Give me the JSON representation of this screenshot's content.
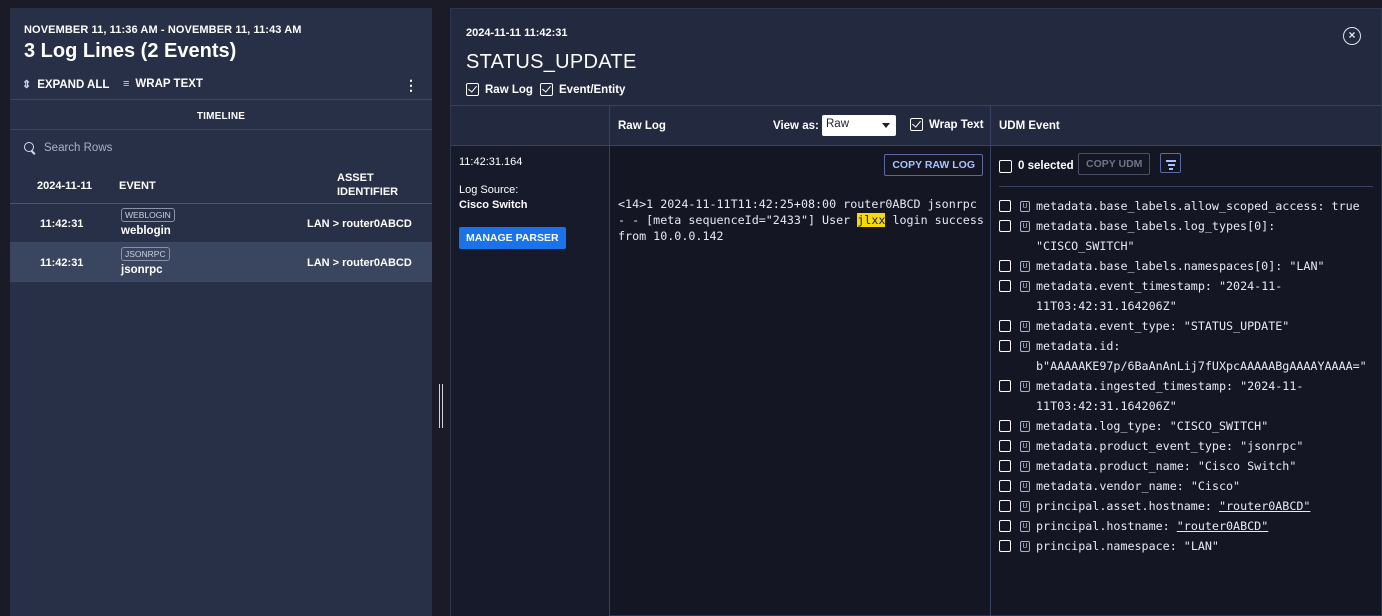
{
  "left": {
    "time_range": "NOVEMBER 11, 11:36 AM - NOVEMBER 11, 11:43 AM",
    "count_title": "3 Log Lines (2 Events)",
    "toolbar": {
      "expand_all": "EXPAND ALL",
      "wrap_text": "WRAP TEXT"
    },
    "tab": "TIMELINE",
    "search_placeholder": "Search Rows",
    "table": {
      "headers": [
        "2024-11-11",
        "EVENT",
        "ASSET",
        "IDENTIFIER"
      ],
      "rows": [
        {
          "time": "11:42:31",
          "badge": "WEBLOGIN",
          "event": "weblogin",
          "asset": "LAN > router0ABCD",
          "selected": false
        },
        {
          "time": "11:42:31",
          "badge": "JSONRPC",
          "event": "jsonrpc",
          "asset": "LAN > router0ABCD",
          "selected": true
        }
      ]
    }
  },
  "detail": {
    "timestamp": "2024-11-11 11:42:31",
    "event_type": "STATUS_UPDATE",
    "options": {
      "raw_log": "Raw Log",
      "event_entity": "Event/Entity"
    },
    "columns": {
      "raw_log": "Raw Log",
      "view_as": "View as:",
      "view_value": "Raw",
      "wrap_text": "Wrap Text",
      "udm_event": "UDM Event"
    },
    "meta": {
      "time": "11:42:31.164",
      "log_source_label": "Log Source:",
      "log_source_value": "Cisco Switch",
      "manage_parser": "MANAGE PARSER"
    },
    "raw": {
      "copy_button": "COPY RAW LOG",
      "before": "<14>1 2024-11-11T11:42:25+08:00 router0ABCD jsonrpc - - [meta sequenceId=\"2433\"] User ",
      "highlight": "jlxx",
      "after": " login success from 10.0.0.142"
    },
    "udm": {
      "selected_count": "0 selected",
      "copy_button": "COPY UDM",
      "fields": [
        {
          "key": "metadata.base_labels.allow_scoped_access:",
          "value": "true",
          "link": false
        },
        {
          "key": "metadata.base_labels.log_types[0]:",
          "value": "\"CISCO_SWITCH\"",
          "link": false
        },
        {
          "key": "metadata.base_labels.namespaces[0]:",
          "value": "\"LAN\"",
          "link": false
        },
        {
          "key": "metadata.event_timestamp:",
          "value": "\"2024-11-11T03:42:31.164206Z\"",
          "link": false
        },
        {
          "key": "metadata.event_type:",
          "value": "\"STATUS_UPDATE\"",
          "link": false
        },
        {
          "key": "metadata.id:",
          "value": "b\"AAAAAKE97p/6BaAnAnLij7fUXpcAAAAABgAAAAYAAAA=\"",
          "link": false
        },
        {
          "key": "metadata.ingested_timestamp:",
          "value": "\"2024-11-11T03:42:31.164206Z\"",
          "link": false
        },
        {
          "key": "metadata.log_type:",
          "value": "\"CISCO_SWITCH\"",
          "link": false
        },
        {
          "key": "metadata.product_event_type:",
          "value": "\"jsonrpc\"",
          "link": false
        },
        {
          "key": "metadata.product_name:",
          "value": "\"Cisco Switch\"",
          "link": false
        },
        {
          "key": "metadata.vendor_name:",
          "value": "\"Cisco\"",
          "link": false
        },
        {
          "key": "principal.asset.hostname:",
          "value": "\"router0ABCD\"",
          "link": true
        },
        {
          "key": "principal.hostname:",
          "value": "\"router0ABCD\"",
          "link": true
        },
        {
          "key": "principal.namespace:",
          "value": "\"LAN\"",
          "link": false
        }
      ]
    }
  },
  "colors": {
    "primary_button": "#1a73e8",
    "highlight": "#f5d90a",
    "panel": "#283048"
  }
}
